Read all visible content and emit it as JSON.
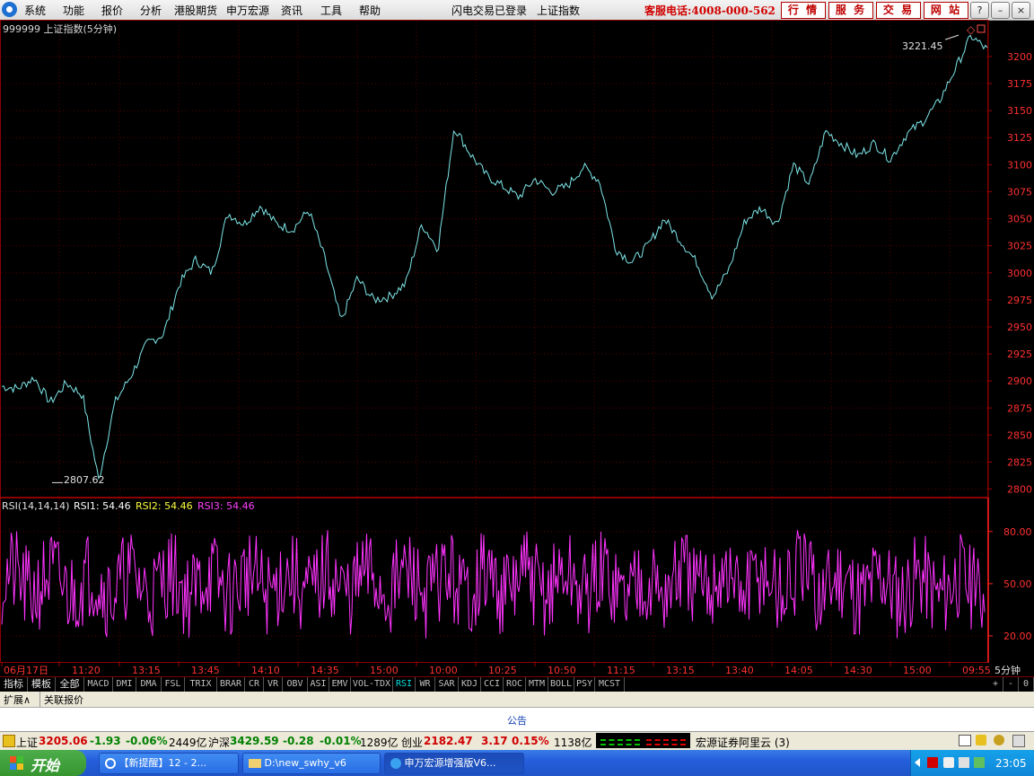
{
  "menu": {
    "items": [
      "系统",
      "功能",
      "报价",
      "分析",
      "港股期货",
      "申万宏源",
      "资讯",
      "工具",
      "帮助"
    ],
    "flash_trade": "闪电交易已登录",
    "index_name": "上证指数",
    "hotline": "客服电话:4008-000-562",
    "buttons": [
      "行 情",
      "服 务",
      "交 易",
      "网 站"
    ]
  },
  "chart_data": {
    "type": "line",
    "title": "999999 上证指数(5分钟)",
    "y_ticks": [
      2800,
      2825,
      2850,
      2875,
      2900,
      2925,
      2950,
      2975,
      3000,
      3025,
      3050,
      3075,
      3100,
      3125,
      3150,
      3175,
      3200
    ],
    "ylim": [
      2793,
      3234
    ],
    "high_label": "3221.45",
    "low_label": "2807.62",
    "x_labels": [
      "06月17日",
      "11:20",
      "13:15",
      "13:45",
      "14:10",
      "14:35",
      "15:00",
      "10:00",
      "10:25",
      "10:50",
      "11:15",
      "13:15",
      "13:40",
      "14:05",
      "14:30",
      "15:00",
      "09:55"
    ],
    "x_unit": "5分钟",
    "series_anchors": [
      2895,
      2893,
      2903,
      2880,
      2898,
      2887,
      2808,
      2880,
      2905,
      2935,
      2943,
      2990,
      3012,
      3000,
      3055,
      3045,
      3062,
      3045,
      3040,
      3058,
      3013,
      2955,
      2995,
      2975,
      2978,
      2990,
      3045,
      3022,
      3135,
      3110,
      3090,
      3080,
      3070,
      3087,
      3075,
      3080,
      3098,
      3085,
      3022,
      3010,
      3025,
      3050,
      3030,
      3010,
      2978,
      3003,
      3048,
      3060,
      3045,
      3100,
      3082,
      3131,
      3119,
      3108,
      3120,
      3105,
      3128,
      3140,
      3158,
      3188,
      3219,
      3206
    ],
    "rsi": {
      "title": "RSI(14,14,14)",
      "rsi1": "RSI1: 54.46",
      "rsi2": "RSI2: 54.46",
      "rsi3": "RSI3: 54.46",
      "y_ticks": [
        20,
        50,
        80
      ],
      "ylim": [
        5,
        99
      ]
    }
  },
  "tabs": [
    "指标",
    "模板",
    "全部",
    "MACD",
    "DMI",
    "DMA",
    "FSL",
    "TRIX",
    "BRAR",
    "CR",
    "VR",
    "OBV",
    "ASI",
    "EMV",
    "VOL-TDX",
    "RSI",
    "WR",
    "SAR",
    "KDJ",
    "CCI",
    "ROC",
    "MTM",
    "BOLL",
    "PSY",
    "MCST"
  ],
  "active_tab": "RSI",
  "tab_controls": [
    "+",
    "-",
    "0"
  ],
  "expand": {
    "label": "扩展∧",
    "linked": "关联报价"
  },
  "notice": "公告",
  "status": {
    "sh_name": "上证",
    "sh_value": "3205.06",
    "sh_chg": "-1.93",
    "sh_pct": "-0.06%",
    "sh_amt": "2449亿",
    "hs_name": "沪深",
    "hs_value": "3429.59",
    "hs_chg": "-0.28",
    "hs_pct": "-0.01%",
    "hs_amt": "1289亿",
    "cy_name": "创业",
    "cy_value": "2182.47",
    "cy_chg": "3.17",
    "cy_pct": "0.15%",
    "cy_amt": "1138亿",
    "server": "宏源证券阿里云 (3)"
  },
  "taskbar": {
    "start": "开始",
    "tasks": [
      "【新提醒】12 - 2...",
      "D:\\new_swhy_v6",
      "申万宏源增强版V6..."
    ],
    "clock": "23:05"
  }
}
